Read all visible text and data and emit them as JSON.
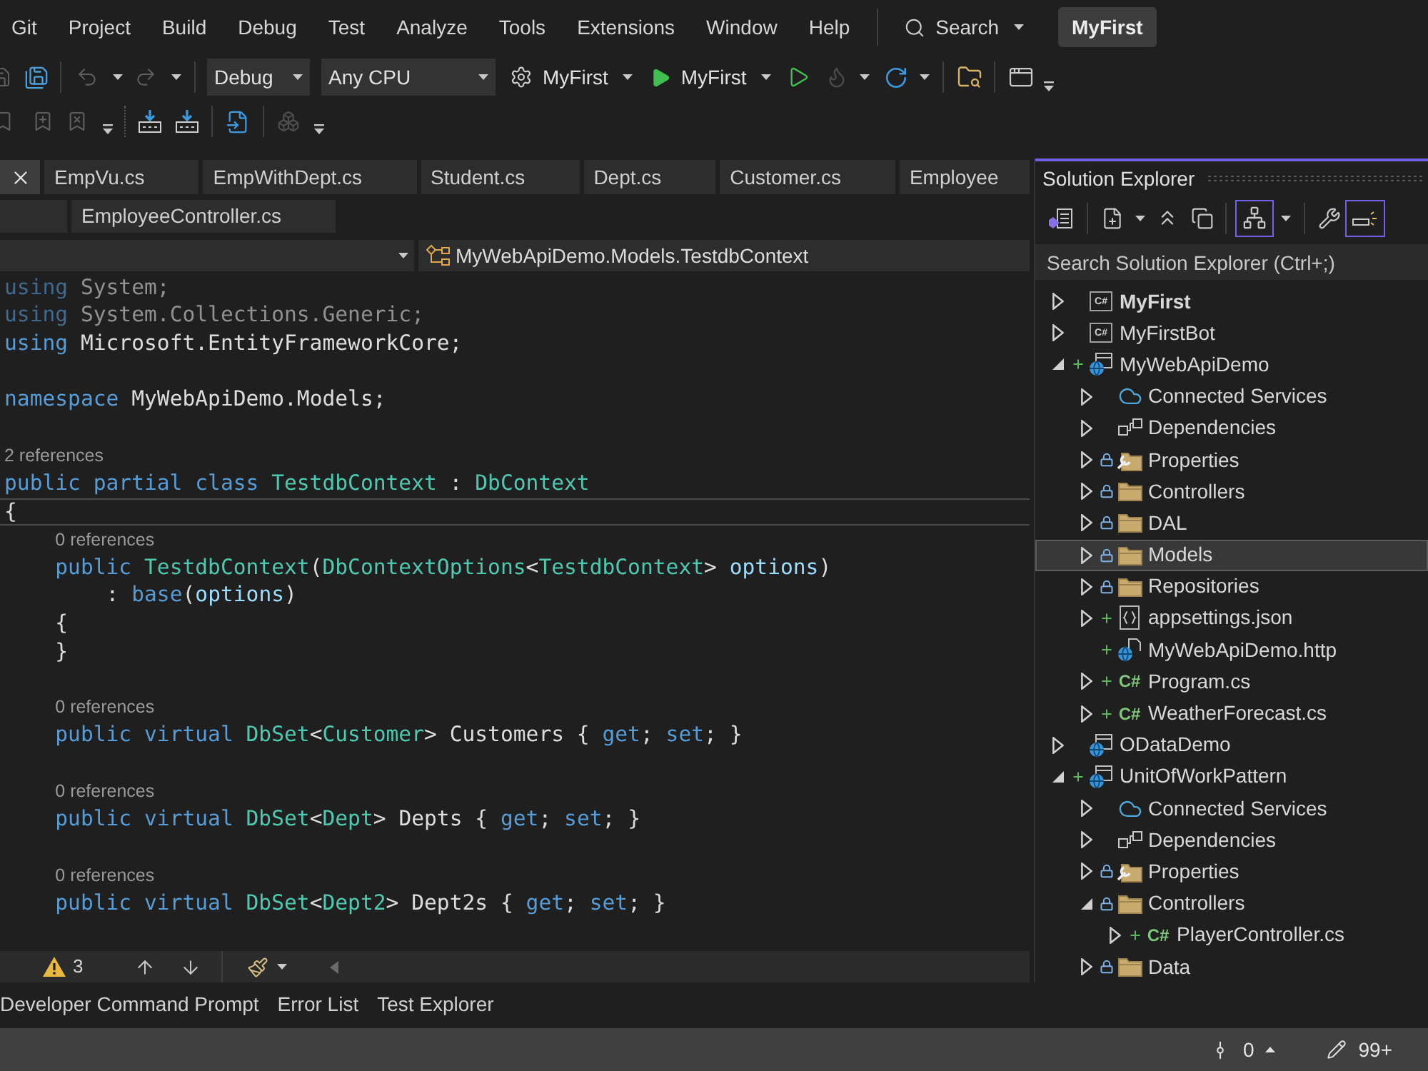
{
  "menu": [
    "Git",
    "Project",
    "Build",
    "Debug",
    "Test",
    "Analyze",
    "Tools",
    "Extensions",
    "Window",
    "Help"
  ],
  "search": {
    "label": "Search"
  },
  "solution_name": "MyFirst",
  "toolbar": {
    "undo": {
      "disabled": true
    },
    "redo": {
      "disabled": true
    },
    "configuration": "Debug",
    "platform": "Any CPU",
    "startup_project": "MyFirst",
    "run_target": "MyFirst",
    "hot_reload": {
      "disabled": true
    }
  },
  "editor_tab_rows": [
    {
      "tabs": [
        {
          "kind": "close",
          "selected": true
        },
        {
          "kind": "file",
          "label": "EmpVu.cs",
          "selected": false
        },
        {
          "kind": "file",
          "label": "EmpWithDept.cs",
          "selected": false
        },
        {
          "kind": "file",
          "label": "Student.cs",
          "selected": false
        },
        {
          "kind": "file",
          "label": "Dept.cs",
          "selected": false
        },
        {
          "kind": "file",
          "label": "Customer.cs",
          "selected": false
        },
        {
          "kind": "file",
          "label": "Employee",
          "selected": false
        }
      ]
    },
    {
      "tabs": [
        {
          "kind": "blank",
          "selected": false
        },
        {
          "kind": "file",
          "label": "EmployeeController.cs",
          "selected": false
        }
      ]
    }
  ],
  "navigation_bar": {
    "type_scope": "MyWebApiDemo.Models.TestdbContext"
  },
  "code_lines": [
    {
      "kind": "code",
      "faded": true,
      "current": false,
      "tokens": [
        {
          "text": "using",
          "kind": "keyword"
        },
        {
          "text": " System;",
          "kind": "plain"
        }
      ]
    },
    {
      "kind": "code",
      "faded": true,
      "current": false,
      "tokens": [
        {
          "text": "using",
          "kind": "keyword"
        },
        {
          "text": " System.Collections.Generic;",
          "kind": "plain"
        }
      ]
    },
    {
      "kind": "code",
      "faded": false,
      "current": false,
      "tokens": [
        {
          "text": "using",
          "kind": "keyword"
        },
        {
          "text": " Microsoft.EntityFrameworkCore;",
          "kind": "plain"
        }
      ]
    },
    {
      "kind": "blank"
    },
    {
      "kind": "code",
      "faded": false,
      "current": false,
      "tokens": [
        {
          "text": "namespace",
          "kind": "keyword"
        },
        {
          "text": " MyWebApiDemo.Models;",
          "kind": "plain"
        }
      ]
    },
    {
      "kind": "blank"
    },
    {
      "kind": "codelens",
      "text": "2 references"
    },
    {
      "kind": "code",
      "faded": false,
      "current": false,
      "tokens": [
        {
          "text": "public partial class",
          "kind": "keyword"
        },
        {
          "text": " TestdbContext",
          "kind": "type"
        },
        {
          "text": " : ",
          "kind": "plain"
        },
        {
          "text": "DbContext",
          "kind": "type"
        }
      ]
    },
    {
      "kind": "code",
      "faded": false,
      "current": true,
      "tokens": [
        {
          "text": "{",
          "kind": "plain"
        }
      ]
    },
    {
      "kind": "codelens",
      "text": "0 references"
    },
    {
      "kind": "code",
      "faded": false,
      "current": false,
      "tokens": [
        {
          "text": "    public",
          "kind": "keyword"
        },
        {
          "text": " TestdbContext",
          "kind": "type"
        },
        {
          "text": "(",
          "kind": "plain"
        },
        {
          "text": "DbContextOptions",
          "kind": "type"
        },
        {
          "text": "<",
          "kind": "plain"
        },
        {
          "text": "TestdbContext",
          "kind": "type"
        },
        {
          "text": "> ",
          "kind": "plain"
        },
        {
          "text": "options",
          "kind": "parameter"
        },
        {
          "text": ")",
          "kind": "plain"
        }
      ]
    },
    {
      "kind": "code",
      "faded": false,
      "current": false,
      "tokens": [
        {
          "text": "        : ",
          "kind": "plain"
        },
        {
          "text": "base",
          "kind": "keyword"
        },
        {
          "text": "(",
          "kind": "plain"
        },
        {
          "text": "options",
          "kind": "parameter"
        },
        {
          "text": ")",
          "kind": "plain"
        }
      ]
    },
    {
      "kind": "code",
      "faded": false,
      "current": false,
      "tokens": [
        {
          "text": "    {",
          "kind": "plain"
        }
      ]
    },
    {
      "kind": "code",
      "faded": false,
      "current": false,
      "tokens": [
        {
          "text": "    }",
          "kind": "plain"
        }
      ]
    },
    {
      "kind": "blank"
    },
    {
      "kind": "codelens",
      "text": "0 references"
    },
    {
      "kind": "code",
      "faded": false,
      "current": false,
      "tokens": [
        {
          "text": "    public virtual",
          "kind": "keyword"
        },
        {
          "text": " DbSet",
          "kind": "type"
        },
        {
          "text": "<",
          "kind": "plain"
        },
        {
          "text": "Customer",
          "kind": "type"
        },
        {
          "text": "> Customers { ",
          "kind": "plain"
        },
        {
          "text": "get",
          "kind": "keyword"
        },
        {
          "text": "; ",
          "kind": "plain"
        },
        {
          "text": "set",
          "kind": "keyword"
        },
        {
          "text": "; }",
          "kind": "plain"
        }
      ]
    },
    {
      "kind": "blank"
    },
    {
      "kind": "codelens",
      "text": "0 references"
    },
    {
      "kind": "code",
      "faded": false,
      "current": false,
      "tokens": [
        {
          "text": "    public virtual",
          "kind": "keyword"
        },
        {
          "text": " DbSet",
          "kind": "type"
        },
        {
          "text": "<",
          "kind": "plain"
        },
        {
          "text": "Dept",
          "kind": "type"
        },
        {
          "text": "> Depts { ",
          "kind": "plain"
        },
        {
          "text": "get",
          "kind": "keyword"
        },
        {
          "text": "; ",
          "kind": "plain"
        },
        {
          "text": "set",
          "kind": "keyword"
        },
        {
          "text": "; }",
          "kind": "plain"
        }
      ]
    },
    {
      "kind": "blank"
    },
    {
      "kind": "codelens",
      "text": "0 references"
    },
    {
      "kind": "code",
      "faded": false,
      "current": false,
      "tokens": [
        {
          "text": "    public virtual",
          "kind": "keyword"
        },
        {
          "text": " DbSet",
          "kind": "type"
        },
        {
          "text": "<",
          "kind": "plain"
        },
        {
          "text": "Dept2",
          "kind": "type"
        },
        {
          "text": "> Dept2s { ",
          "kind": "plain"
        },
        {
          "text": "get",
          "kind": "keyword"
        },
        {
          "text": "; ",
          "kind": "plain"
        },
        {
          "text": "set",
          "kind": "keyword"
        },
        {
          "text": "; }",
          "kind": "plain"
        }
      ]
    }
  ],
  "editor_status": {
    "warnings": "3"
  },
  "solution_explorer": {
    "title": "Solution Explorer",
    "toolbar": {
      "show_all_files": {
        "on": true
      },
      "preview": {
        "on": true
      }
    },
    "search": {
      "placeholder": "Search Solution Explorer (Ctrl+;)"
    },
    "tree": [
      {
        "label": "MyFirst",
        "kind": "csharp-project",
        "icon_text": "C#",
        "expandable": true,
        "expanded": false,
        "locked": false,
        "added": false,
        "selected": false,
        "startup": true
      },
      {
        "label": "MyFirstBot",
        "kind": "csharp-project",
        "icon_text": "C#",
        "expandable": true,
        "expanded": false,
        "locked": false,
        "added": false,
        "selected": false,
        "startup": false
      },
      {
        "label": "MyWebApiDemo",
        "kind": "web-project",
        "expandable": true,
        "expanded": true,
        "locked": false,
        "added": true,
        "selected": false,
        "startup": false,
        "children": [
          {
            "label": "Connected Services",
            "kind": "connected-services",
            "expandable": true,
            "expanded": false,
            "locked": false,
            "added": false,
            "selected": false
          },
          {
            "label": "Dependencies",
            "kind": "dependencies",
            "expandable": true,
            "expanded": false,
            "locked": false,
            "added": false,
            "selected": false
          },
          {
            "label": "Properties",
            "kind": "properties",
            "expandable": true,
            "expanded": false,
            "locked": true,
            "added": false,
            "selected": false
          },
          {
            "label": "Controllers",
            "kind": "folder",
            "expandable": true,
            "expanded": false,
            "locked": true,
            "added": false,
            "selected": false
          },
          {
            "label": "DAL",
            "kind": "folder",
            "expandable": true,
            "expanded": false,
            "locked": true,
            "added": false,
            "selected": false
          },
          {
            "label": "Models",
            "kind": "folder",
            "expandable": true,
            "expanded": false,
            "locked": true,
            "added": false,
            "selected": true
          },
          {
            "label": "Repositories",
            "kind": "folder",
            "expandable": true,
            "expanded": false,
            "locked": true,
            "added": false,
            "selected": false
          },
          {
            "label": "appsettings.json",
            "kind": "json",
            "expandable": true,
            "expanded": false,
            "locked": false,
            "added": true,
            "selected": false
          },
          {
            "label": "MyWebApiDemo.http",
            "kind": "http",
            "expandable": false,
            "expanded": false,
            "locked": false,
            "added": true,
            "selected": false
          },
          {
            "label": "Program.cs",
            "kind": "csharp-file",
            "icon_text": "C#",
            "expandable": true,
            "expanded": false,
            "locked": false,
            "added": true,
            "selected": false
          },
          {
            "label": "WeatherForecast.cs",
            "kind": "csharp-file",
            "icon_text": "C#",
            "expandable": true,
            "expanded": false,
            "locked": false,
            "added": true,
            "selected": false
          }
        ]
      },
      {
        "label": "ODataDemo",
        "kind": "web-project",
        "expandable": true,
        "expanded": false,
        "locked": false,
        "added": false,
        "selected": false,
        "startup": false
      },
      {
        "label": "UnitOfWorkPattern",
        "kind": "web-project",
        "expandable": true,
        "expanded": true,
        "locked": false,
        "added": true,
        "selected": false,
        "startup": false,
        "children": [
          {
            "label": "Connected Services",
            "kind": "connected-services",
            "expandable": true,
            "expanded": false,
            "locked": false,
            "added": false,
            "selected": false
          },
          {
            "label": "Dependencies",
            "kind": "dependencies",
            "expandable": true,
            "expanded": false,
            "locked": false,
            "added": false,
            "selected": false
          },
          {
            "label": "Properties",
            "kind": "properties",
            "expandable": true,
            "expanded": false,
            "locked": true,
            "added": false,
            "selected": false
          },
          {
            "label": "Controllers",
            "kind": "folder",
            "expandable": true,
            "expanded": true,
            "locked": true,
            "added": false,
            "selected": false,
            "children": [
              {
                "label": "PlayerController.cs",
                "kind": "csharp-file",
                "icon_text": "C#",
                "expandable": true,
                "expanded": false,
                "locked": false,
                "added": true,
                "selected": false
              }
            ]
          },
          {
            "label": "Data",
            "kind": "folder",
            "expandable": true,
            "expanded": false,
            "locked": true,
            "added": false,
            "selected": false
          }
        ]
      }
    ]
  },
  "bottom_tabs": [
    {
      "label": "Developer Command Prompt",
      "selected": false
    },
    {
      "label": "Error List",
      "selected": false
    },
    {
      "label": "Test Explorer",
      "selected": false
    }
  ],
  "status_bar": {
    "pushes": "0",
    "changes": "99+"
  }
}
